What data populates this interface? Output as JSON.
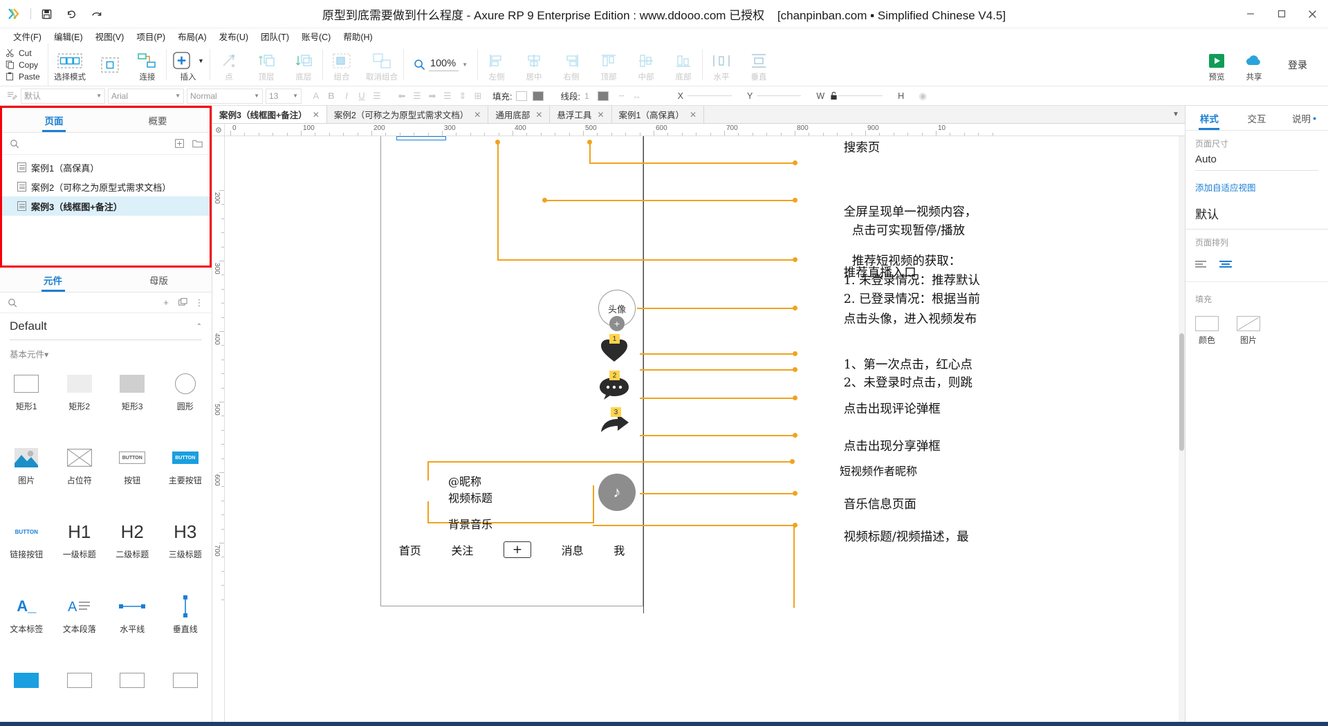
{
  "window": {
    "title": "原型到底需要做到什么程度 - Axure RP 9 Enterprise Edition : www.ddooo.com 已授权",
    "license": "[chanpinban.com ▪ Simplified Chinese V4.5]",
    "minimize": "–",
    "maximize": "☐",
    "close": "✕",
    "quick": {
      "save": "save-icon",
      "undo": "undo-icon",
      "redo": "redo-icon"
    }
  },
  "menubar": {
    "items": [
      "文件(F)",
      "编辑(E)",
      "视图(V)",
      "项目(P)",
      "布局(A)",
      "发布(U)",
      "团队(T)",
      "账号(C)",
      "帮助(H)"
    ]
  },
  "toolbar": {
    "clipboard": [
      {
        "label": "Cut",
        "icon": "scissors-icon"
      },
      {
        "label": "Copy",
        "icon": "copy-icon"
      },
      {
        "label": "Paste",
        "icon": "paste-icon"
      }
    ],
    "items": [
      {
        "label": "选择模式",
        "icon": "selection-mode-icon",
        "disabled": false
      },
      {
        "label": "连接",
        "icon": "connect-icon",
        "disabled": false
      },
      {
        "label": "插入",
        "icon": "insert-plus-icon",
        "disabled": false,
        "dropdown": true
      },
      {
        "label": "点",
        "icon": "point-icon",
        "disabled": true
      },
      {
        "label": "顶层",
        "icon": "bring-to-front-icon",
        "disabled": true
      },
      {
        "label": "底层",
        "icon": "send-to-back-icon",
        "disabled": true
      },
      {
        "label": "组合",
        "icon": "group-icon",
        "disabled": true
      },
      {
        "label": "取消组合",
        "icon": "ungroup-icon",
        "disabled": true
      }
    ],
    "zoom": {
      "value": "100%",
      "icon": "zoom-icon"
    },
    "align_items": [
      {
        "label": "左侧",
        "icon": "align-left-icon"
      },
      {
        "label": "居中",
        "icon": "align-center-icon"
      },
      {
        "label": "右侧",
        "icon": "align-right-icon"
      },
      {
        "label": "顶部",
        "icon": "align-top-icon"
      },
      {
        "label": "中部",
        "icon": "align-middle-icon"
      },
      {
        "label": "底部",
        "icon": "align-bottom-icon"
      },
      {
        "label": "水平",
        "icon": "distribute-horizontal-icon"
      },
      {
        "label": "垂直",
        "icon": "distribute-vertical-icon"
      }
    ],
    "right_items": [
      {
        "label": "预览",
        "icon": "preview-play-icon"
      },
      {
        "label": "共享",
        "icon": "share-cloud-icon"
      }
    ],
    "login": "登录"
  },
  "formatbar": {
    "style_name": "默认",
    "font_family": "Arial",
    "font_weight": "Normal",
    "font_size": "13",
    "fill_label": "填充:",
    "line_label": "线段:",
    "line_width": "1",
    "coords": {
      "x": "X",
      "y": "Y",
      "w": "W",
      "h": "H"
    }
  },
  "left_panel": {
    "pages": {
      "tabs": [
        {
          "label": "页面",
          "active": true
        },
        {
          "label": "概要",
          "active": false
        }
      ],
      "search_placeholder": "",
      "toolbar_icons": [
        "add-page-icon",
        "add-folder-icon"
      ],
      "items": [
        {
          "label": "案例1（高保真）",
          "selected": false
        },
        {
          "label": "案例2（可称之为原型式需求文档）",
          "selected": false
        },
        {
          "label": "案例3（线框图+备注）",
          "selected": true
        }
      ]
    },
    "library": {
      "tabs": [
        {
          "label": "元件",
          "active": true
        },
        {
          "label": "母版",
          "active": false
        }
      ],
      "toolbar_icons": [
        "add-library-icon",
        "duplicate-icon",
        "more-options-icon"
      ],
      "selected_library": "Default",
      "group_label": "基本元件",
      "widgets": [
        {
          "name": "矩形1",
          "art": "rect-outline"
        },
        {
          "name": "矩形2",
          "art": "rect-light"
        },
        {
          "name": "矩形3",
          "art": "rect-grey"
        },
        {
          "name": "圆形",
          "art": "circle-outline"
        },
        {
          "name": "图片",
          "art": "image-icon"
        },
        {
          "name": "占位符",
          "art": "placeholder-icon"
        },
        {
          "name": "按钮",
          "art": "button-icon"
        },
        {
          "name": "主要按钮",
          "art": "primary-button-icon"
        },
        {
          "name": "链接按钮",
          "art": "link-button-icon"
        },
        {
          "name": "一级标题",
          "art": "h1-icon"
        },
        {
          "name": "二级标题",
          "art": "h2-icon"
        },
        {
          "name": "三级标题",
          "art": "h3-icon"
        },
        {
          "name": "文本标签",
          "art": "text-label-icon"
        },
        {
          "name": "文本段落",
          "art": "text-paragraph-icon"
        },
        {
          "name": "水平线",
          "art": "horizontal-line-icon"
        },
        {
          "name": "垂直线",
          "art": "vertical-line-icon"
        }
      ]
    }
  },
  "canvas": {
    "tabs": [
      {
        "label": "案例3（线框图+备注）",
        "active": true
      },
      {
        "label": "案例2（可称之为原型式需求文档）",
        "active": false
      },
      {
        "label": "通用底部",
        "active": false
      },
      {
        "label": "悬浮工具",
        "active": false
      },
      {
        "label": "案例1（高保真）",
        "active": false
      }
    ],
    "hruler_labels": [
      "0",
      "100",
      "200",
      "300",
      "400",
      "500",
      "600",
      "700",
      "800",
      "900",
      "10"
    ],
    "vruler_labels": [
      "200",
      "300",
      "400",
      "500",
      "600",
      "700"
    ],
    "wireframe": {
      "avatar_label": "头像",
      "music_label": "♪",
      "nickname": "@昵称",
      "video_title": "视频标题",
      "bgm": "背景音乐",
      "nav_items": [
        "首页",
        "关注",
        "+",
        "消息",
        "我"
      ]
    },
    "annotations": [
      {
        "text": "搜索页",
        "partial": true
      },
      {
        "text": "推荐直播入口"
      },
      {
        "text": "全屏呈现单一视频内容，"
      },
      {
        "text": "点击可实现暂停/播放"
      },
      {
        "text": "推荐短视频的获取："
      },
      {
        "text": "1. 未登录情况：推荐默认"
      },
      {
        "text": "2. 已登录情况：根据当前"
      },
      {
        "text": "点击头像，进入视频发布"
      },
      {
        "text": "1、第一次点击，红心点"
      },
      {
        "text": "2、未登录时点击，则跳"
      },
      {
        "text": "点击出现评论弹框"
      },
      {
        "text": "点击出现分享弹框"
      },
      {
        "text": "短视频作者昵称"
      },
      {
        "text": "音乐信息页面"
      },
      {
        "text": "视频标题/视频描述，最"
      }
    ],
    "badges": [
      "1",
      "2",
      "3"
    ]
  },
  "right_panel": {
    "tabs": [
      {
        "label": "样式",
        "active": true,
        "dot": false
      },
      {
        "label": "交互",
        "active": false,
        "dot": false
      },
      {
        "label": "说明",
        "active": false,
        "dot": true
      }
    ],
    "page_size_label": "页面尺寸",
    "page_size_value": "Auto",
    "adaptive_link": "添加自适应视图",
    "default_title": "默认",
    "page_align_label": "页面排列",
    "fill_label": "填充",
    "fill_options": [
      {
        "label": "颜色",
        "icon": "color-swatch-icon"
      },
      {
        "label": "图片",
        "icon": "image-swatch-icon"
      }
    ]
  },
  "colors": {
    "accent": "#1a7fd4",
    "annotation": "#f0a31e",
    "highlight_border": "#f4000b",
    "selection": "#dcf0fa",
    "badge": "#ffd34d"
  }
}
